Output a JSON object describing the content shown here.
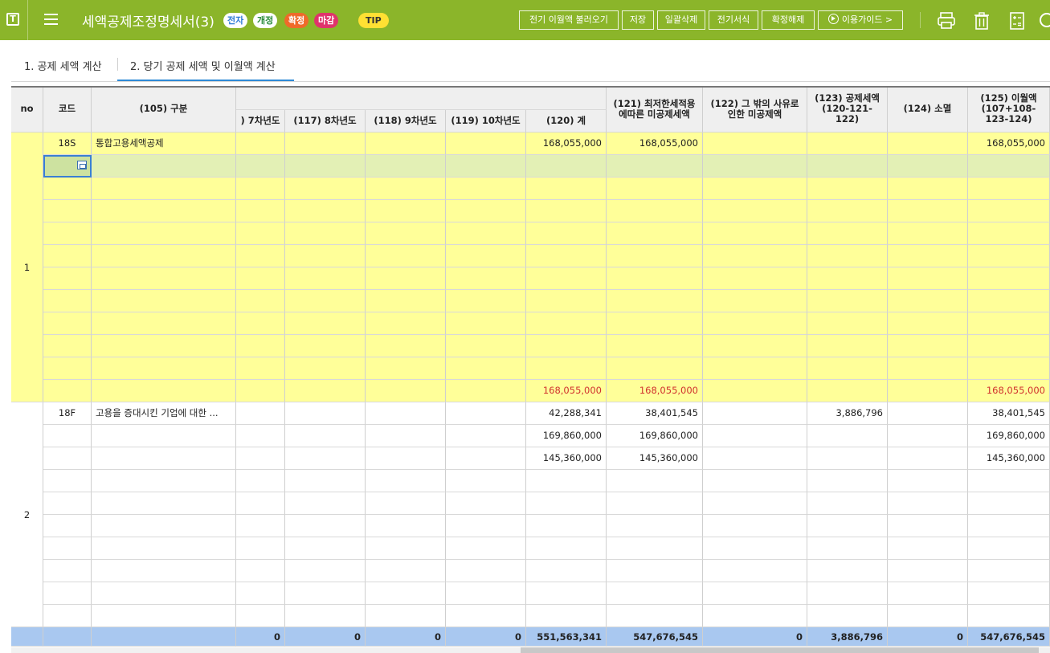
{
  "header": {
    "app_icon_letter": "T",
    "title": "세액공제조정명세서(3)",
    "badges": [
      "전자",
      "개정",
      "확정",
      "마감"
    ],
    "tip_label": "TIP",
    "buttons": [
      "전기 이월액 불러오기",
      "저장",
      "일괄삭제",
      "전기서식",
      "확정해제"
    ],
    "guide_label": "이용가이드 >",
    "icons": [
      "print-icon",
      "trash-icon",
      "calculator-icon",
      "gear-icon"
    ],
    "colors": {
      "bar": "#8bb52a",
      "badge_blue": "#2e7bd6",
      "badge_green": "#2a8c3a",
      "badge_orange": "#ef6a2a",
      "badge_pink": "#e0336b",
      "tip": "#ffe033"
    }
  },
  "tabs": [
    {
      "label": "1. 공제 세액 계산",
      "active": false
    },
    {
      "label": "2. 당기 공제 세액 및 이월액 계산",
      "active": true
    }
  ],
  "table": {
    "headers": {
      "no": "no",
      "code": "코드",
      "category": "(105) 구분",
      "c116": ") 7차년도",
      "c117": "(117) 8차년도",
      "c118": "(118) 9차년도",
      "c119": "(119) 10차년도",
      "c120": "(120) 계",
      "c121": "(121) 최저한세적용에따른 미공제세액",
      "c122": "(122) 그 밖의 사유로 인한 미공제액",
      "c123": "(123) 공제세액 (120-121-122)",
      "c124": "(124) 소멸",
      "c125": "(125) 이월액 (107+108-123-124)"
    },
    "group1": {
      "no": "1",
      "code": "18S",
      "category": "통합고용세액공제",
      "row1": {
        "c120": "168,055,000",
        "c121": "168,055,000",
        "c125": "168,055,000"
      },
      "subtotal": {
        "c120": "168,055,000",
        "c121": "168,055,000",
        "c125": "168,055,000"
      }
    },
    "group2": {
      "no": "2",
      "code": "18F",
      "category": "고용을 증대시킨 기업에 대한 ...",
      "rows": [
        {
          "c120": "42,288,341",
          "c121": "38,401,545",
          "c123": "3,886,796",
          "c125": "38,401,545"
        },
        {
          "c120": "169,860,000",
          "c121": "169,860,000",
          "c123": "",
          "c125": "169,860,000"
        },
        {
          "c120": "145,360,000",
          "c121": "145,360,000",
          "c123": "",
          "c125": "145,360,000"
        }
      ]
    },
    "totals": {
      "c116": "0",
      "c117": "0",
      "c118": "0",
      "c119": "0",
      "c120": "551,563,341",
      "c121": "547,676,545",
      "c122": "0",
      "c123": "3,886,796",
      "c124": "0",
      "c125": "547,676,545"
    }
  }
}
